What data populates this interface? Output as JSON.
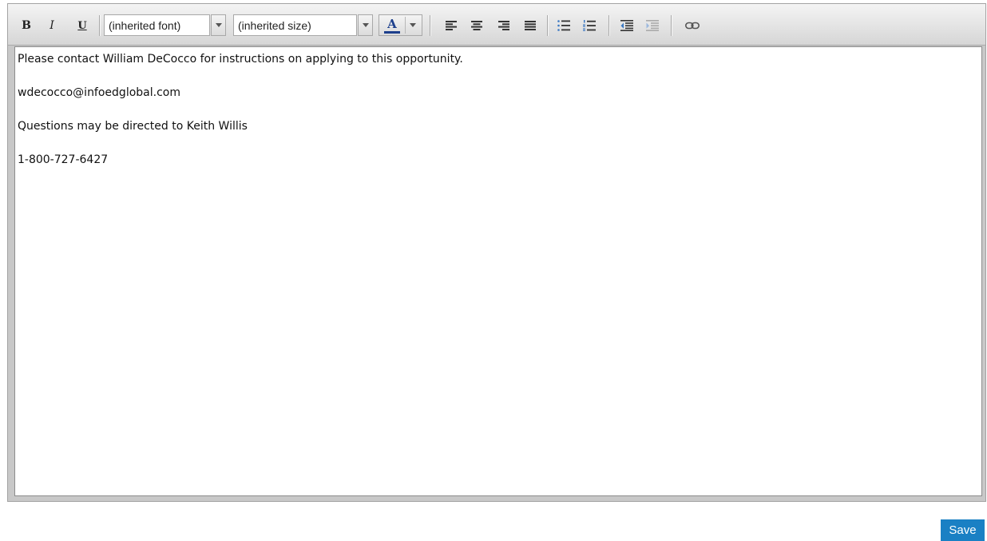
{
  "toolbar": {
    "bold_label": "B",
    "italic_label": "I",
    "underline_label": "U",
    "font_select_value": "(inherited font)",
    "size_select_value": "(inherited size)",
    "text_color_label": "A",
    "text_color": "#1c3f8c",
    "icons": [
      "bold-icon",
      "italic-icon",
      "underline-icon",
      "text-color-icon",
      "align-left-icon",
      "align-center-icon",
      "align-right-icon",
      "align-justify-icon",
      "bullet-list-icon",
      "numbered-list-icon",
      "outdent-icon",
      "indent-icon",
      "link-icon"
    ]
  },
  "editor": {
    "paragraphs": [
      "Please contact William DeCocco for instructions on applying to this opportunity.",
      "wdecocco@infoedglobal.com",
      "Questions may be directed to Keith Willis",
      "1-800-727-6427"
    ]
  },
  "actions": {
    "save_label": "Save",
    "save_color": "#1a80c4"
  }
}
